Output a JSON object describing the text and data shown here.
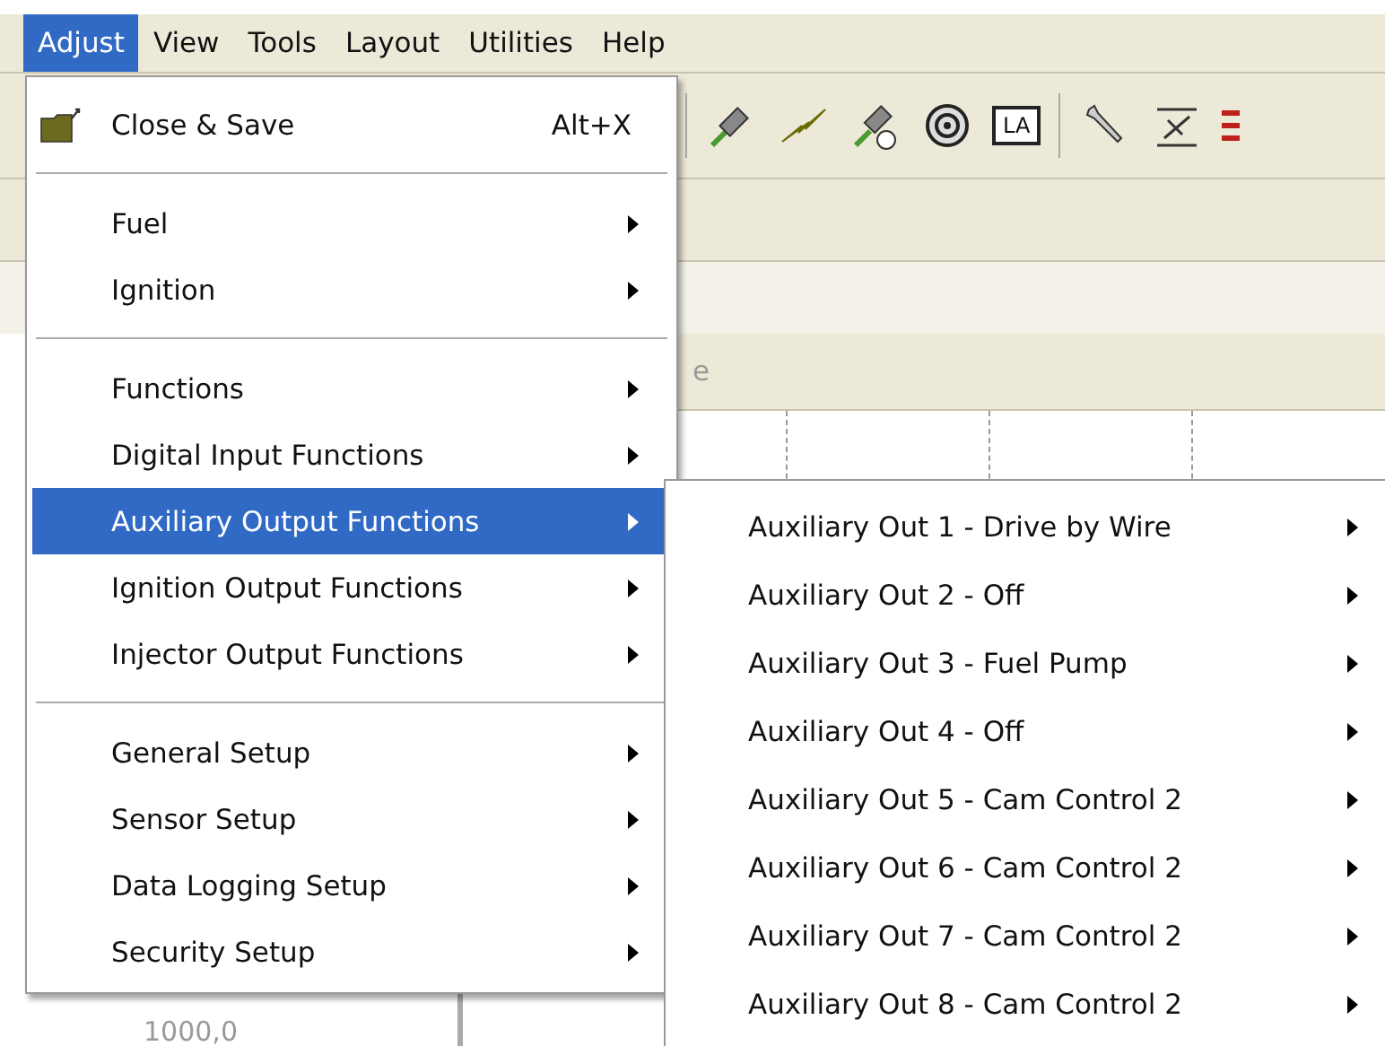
{
  "menubar": [
    {
      "label": "Adjust",
      "selected": true
    },
    {
      "label": "View",
      "selected": false
    },
    {
      "label": "Tools",
      "selected": false
    },
    {
      "label": "Layout",
      "selected": false
    },
    {
      "label": "Utilities",
      "selected": false
    },
    {
      "label": "Help",
      "selected": false
    }
  ],
  "toolbar": {
    "la_label": "LA"
  },
  "background": {
    "header_fragment": "e",
    "cell_value": "1000,0"
  },
  "menu": {
    "items": [
      {
        "kind": "command",
        "label": "Close & Save",
        "shortcut": "Alt+X"
      },
      {
        "kind": "separator"
      },
      {
        "kind": "submenu",
        "label": "Fuel",
        "selected": false
      },
      {
        "kind": "submenu",
        "label": "Ignition",
        "selected": false
      },
      {
        "kind": "separator"
      },
      {
        "kind": "submenu",
        "label": "Functions",
        "selected": false
      },
      {
        "kind": "submenu",
        "label": "Digital Input Functions",
        "selected": false
      },
      {
        "kind": "submenu",
        "label": "Auxiliary Output Functions",
        "selected": true
      },
      {
        "kind": "submenu",
        "label": "Ignition Output Functions",
        "selected": false
      },
      {
        "kind": "submenu",
        "label": "Injector Output Functions",
        "selected": false
      },
      {
        "kind": "separator"
      },
      {
        "kind": "submenu",
        "label": "General Setup",
        "selected": false
      },
      {
        "kind": "submenu",
        "label": "Sensor Setup",
        "selected": false
      },
      {
        "kind": "submenu",
        "label": "Data Logging Setup",
        "selected": false
      },
      {
        "kind": "submenu",
        "label": "Security Setup",
        "selected": false
      }
    ]
  },
  "submenu": {
    "items": [
      {
        "label": "Auxiliary Out 1 - Drive by Wire",
        "selected": false
      },
      {
        "label": "Auxiliary Out 2 - Off",
        "selected": false
      },
      {
        "label": "Auxiliary Out 3 - Fuel Pump",
        "selected": false
      },
      {
        "label": "Auxiliary Out 4 - Off",
        "selected": false
      },
      {
        "label": "Auxiliary Out 5 - Cam Control 2",
        "selected": false
      },
      {
        "label": "Auxiliary Out 6 - Cam Control 2",
        "selected": false
      },
      {
        "label": "Auxiliary Out 7 - Cam Control 2",
        "selected": false
      },
      {
        "label": "Auxiliary Out 8 - Cam Control 2",
        "selected": false
      }
    ]
  }
}
